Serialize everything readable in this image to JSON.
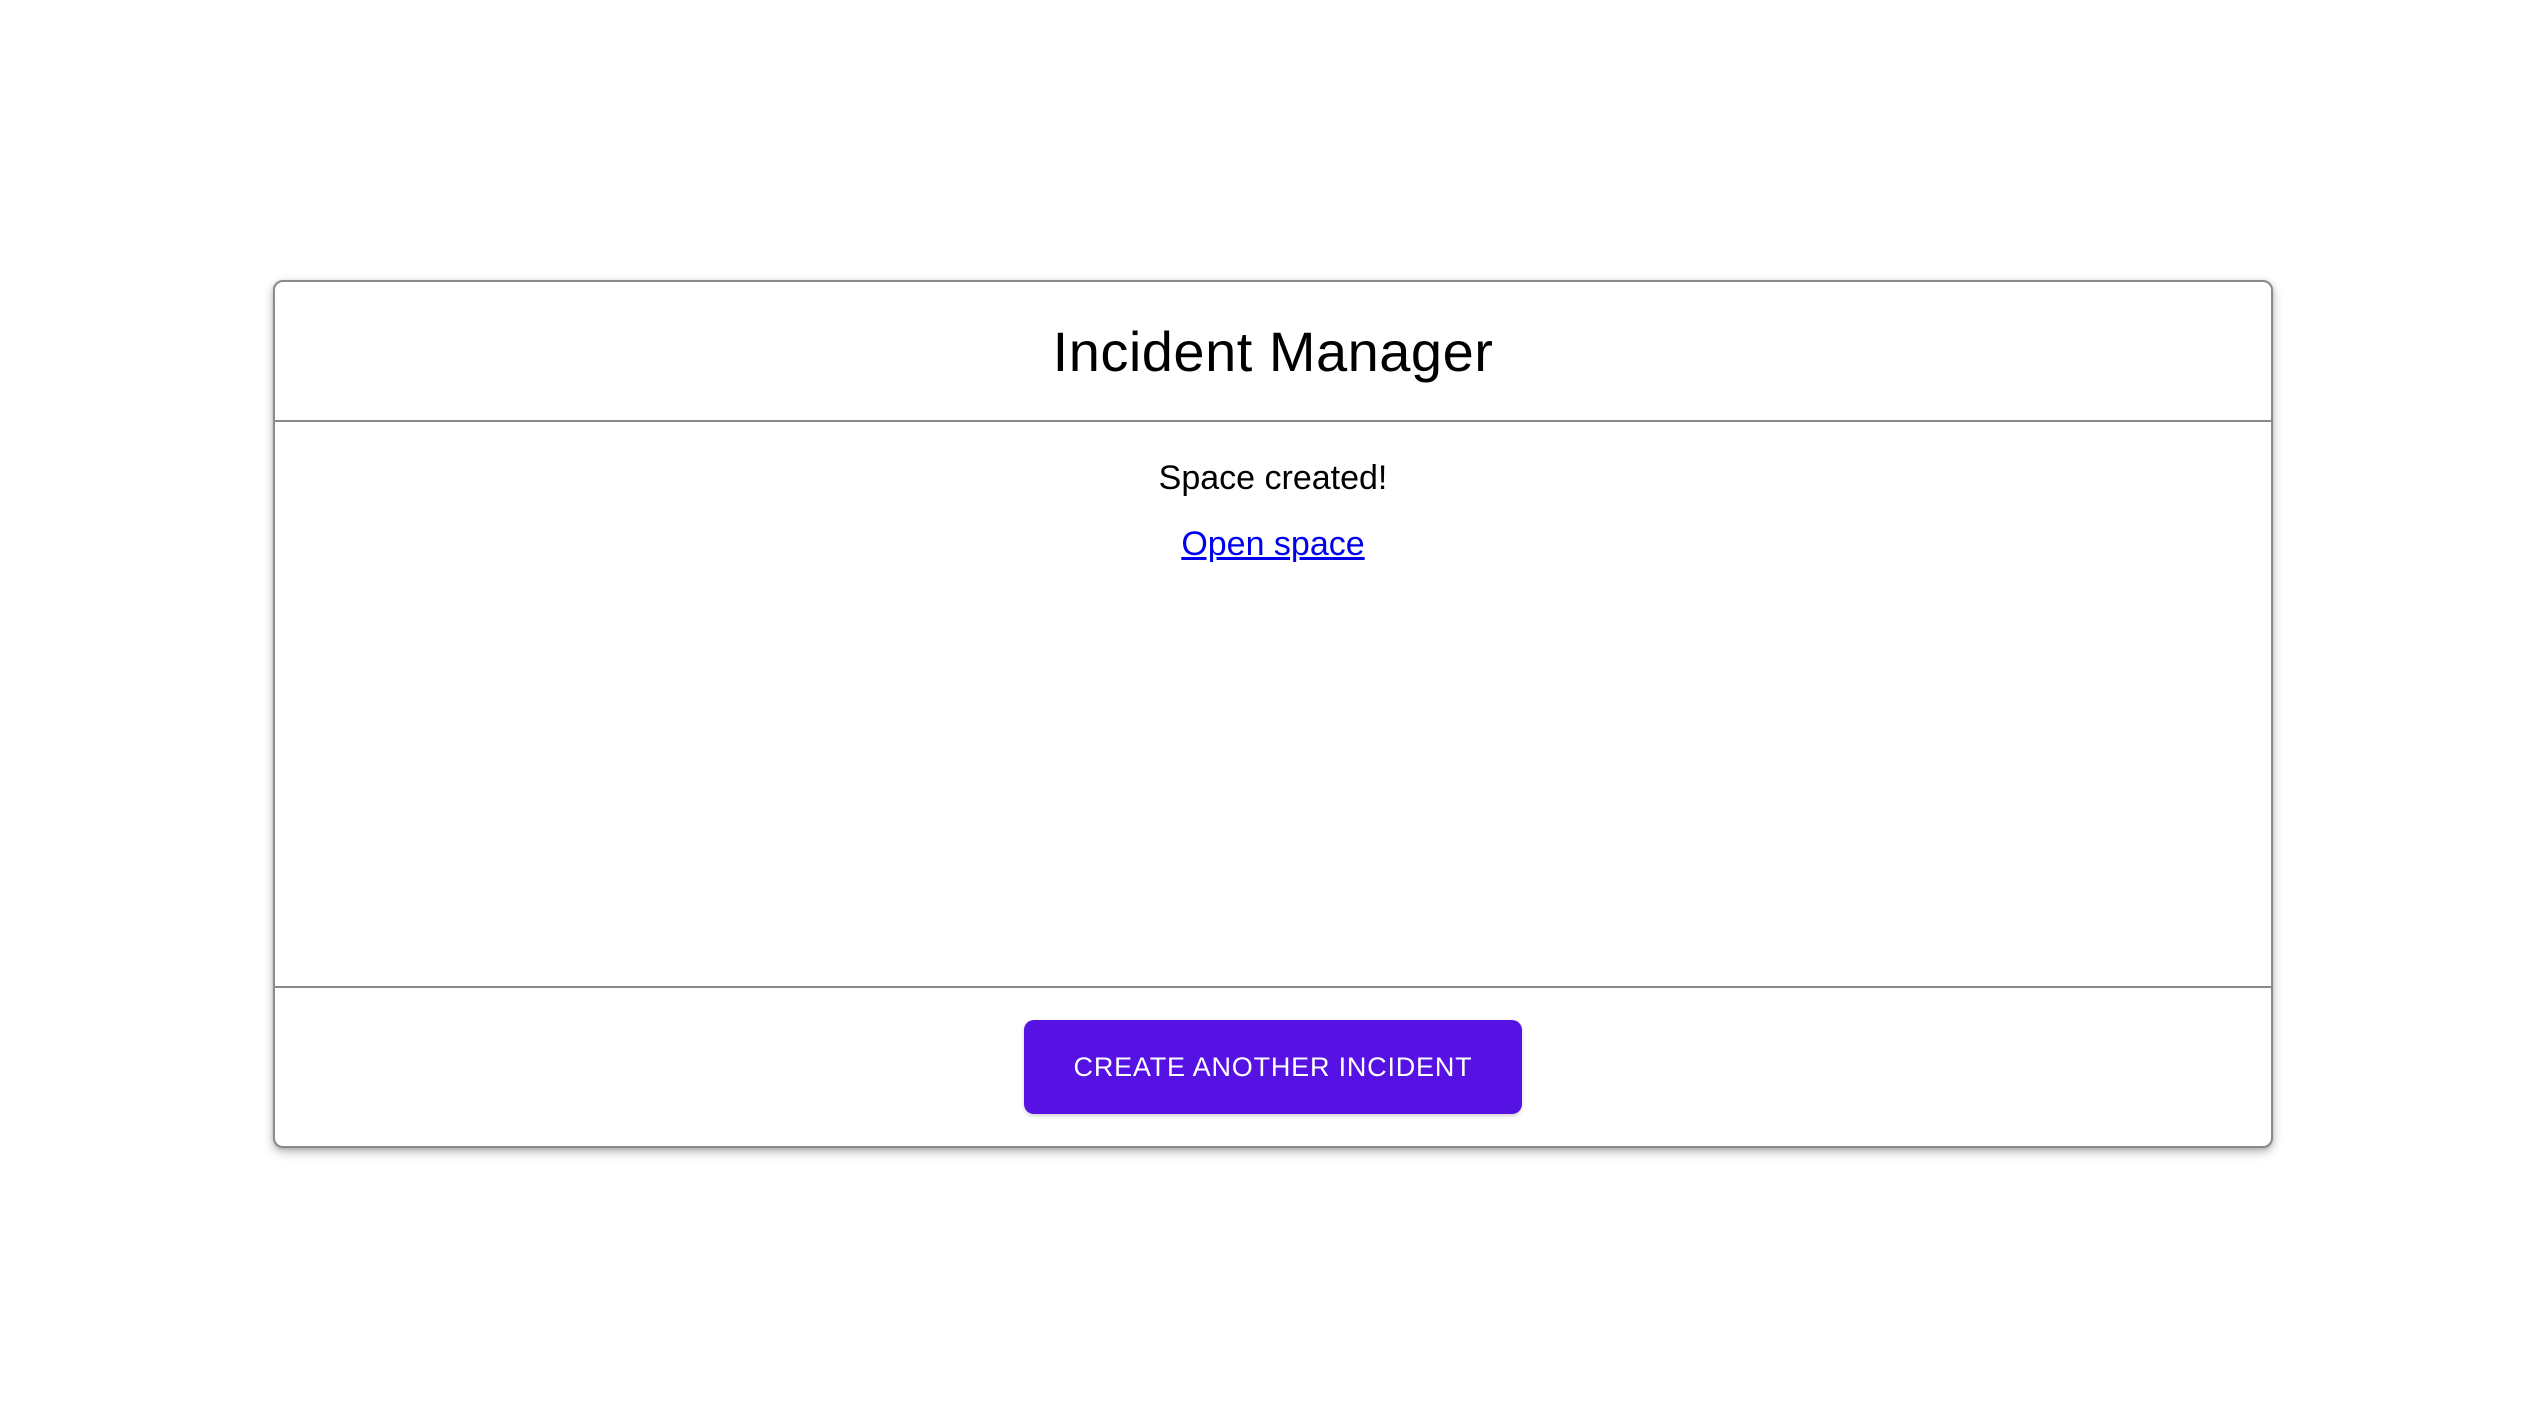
{
  "card": {
    "title": "Incident Manager",
    "status_message": "Space created!",
    "link_label": "Open space",
    "button_label": "CREATE ANOTHER INCIDENT"
  },
  "colors": {
    "background": "#ffffff",
    "border": "#8a8a8a",
    "text": "#000000",
    "link": "#0000ee",
    "button_background": "#5611e3",
    "button_text": "#ffffff"
  }
}
